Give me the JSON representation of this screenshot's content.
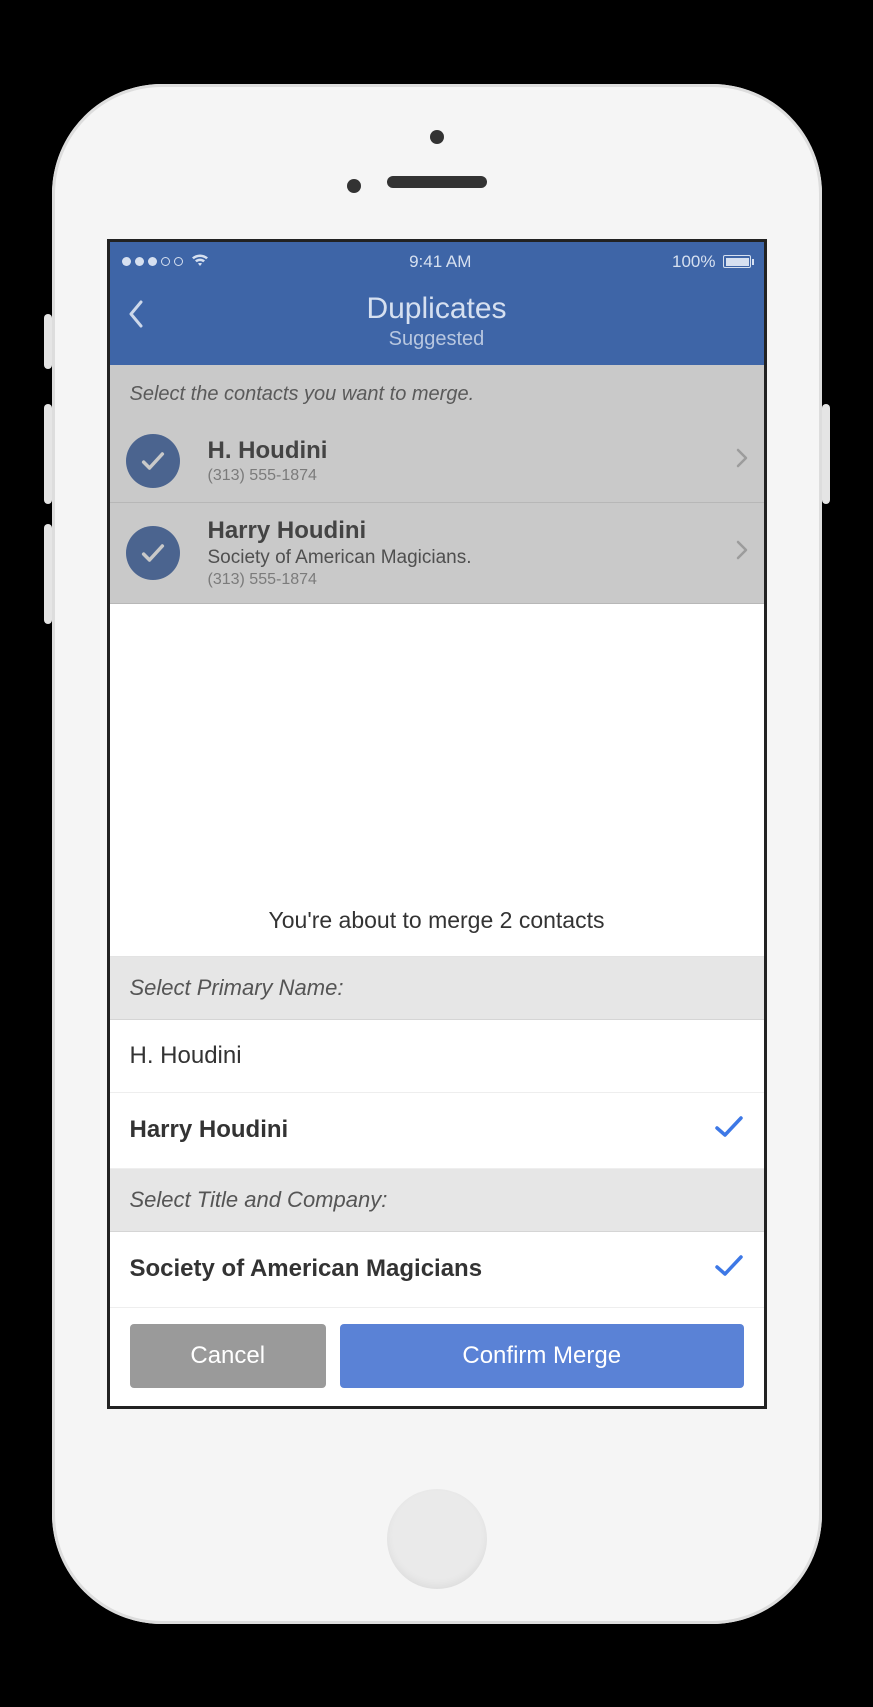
{
  "statusbar": {
    "time": "9:41 AM",
    "battery": "100%"
  },
  "nav": {
    "title": "Duplicates",
    "subtitle": "Suggested"
  },
  "instruction": "Select the contacts you want to merge.",
  "contacts": [
    {
      "name": "H. Houdini",
      "phone": "(313) 555-1874"
    },
    {
      "name": "Harry Houdini",
      "detail": "Society of American Magicians.",
      "phone": "(313) 555-1874"
    }
  ],
  "sheet": {
    "title": "You're about to merge 2 contacts",
    "primary_label": "Select Primary Name:",
    "primary_options": [
      {
        "label": "H. Houdini",
        "selected": false
      },
      {
        "label": "Harry Houdini",
        "selected": true
      }
    ],
    "company_label": "Select Title and Company:",
    "company_options": [
      {
        "label": "Society of American Magicians",
        "selected": true
      }
    ],
    "cancel": "Cancel",
    "confirm": "Confirm Merge"
  }
}
